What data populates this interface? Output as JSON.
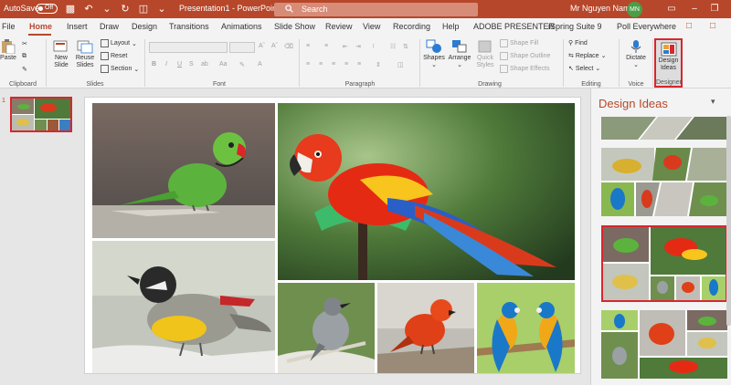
{
  "titlebar": {
    "autosave_label": "AutoSave",
    "autosave_state": "Off",
    "doc_title": "Presentation1 - PowerPoint",
    "search_placeholder": "Search",
    "user_name": "Mr Nguyen Nam",
    "user_initials": "MN"
  },
  "tabs": [
    "File",
    "Home",
    "Insert",
    "Draw",
    "Design",
    "Transitions",
    "Animations",
    "Slide Show",
    "Review",
    "View",
    "Recording",
    "Help",
    "ADOBE PRESENTER",
    "iSpring Suite 9",
    "Poll Everywhere"
  ],
  "active_tab": "Home",
  "ribbon": {
    "clipboard": {
      "paste": "Paste",
      "label": "Clipboard"
    },
    "slides": {
      "new_slide_1": "New",
      "new_slide_2": "Slide",
      "reuse_1": "Reuse",
      "reuse_2": "Slides",
      "layout": "Layout",
      "reset": "Reset",
      "section": "Section",
      "label": "Slides"
    },
    "font": {
      "label": "Font"
    },
    "paragraph": {
      "label": "Paragraph"
    },
    "drawing": {
      "shapes": "Shapes",
      "arrange": "Arrange",
      "quick_1": "Quick",
      "quick_2": "Styles",
      "shape_fill": "Shape Fill",
      "shape_outline": "Shape Outline",
      "shape_effects": "Shape Effects",
      "label": "Drawing"
    },
    "editing": {
      "find": "Find",
      "replace": "Replace",
      "select": "Select",
      "label": "Editing"
    },
    "voice": {
      "dictate": "Dictate",
      "label": "Voice"
    },
    "designer": {
      "design_1": "Design",
      "design_2": "Ideas",
      "label": "Designer"
    }
  },
  "thumbnails": {
    "slide_number": "1"
  },
  "design_pane": {
    "title": "Design Ideas"
  },
  "colors": {
    "accent": "#b7472a",
    "highlight": "#d9262d",
    "avatar": "#4b9e47"
  }
}
